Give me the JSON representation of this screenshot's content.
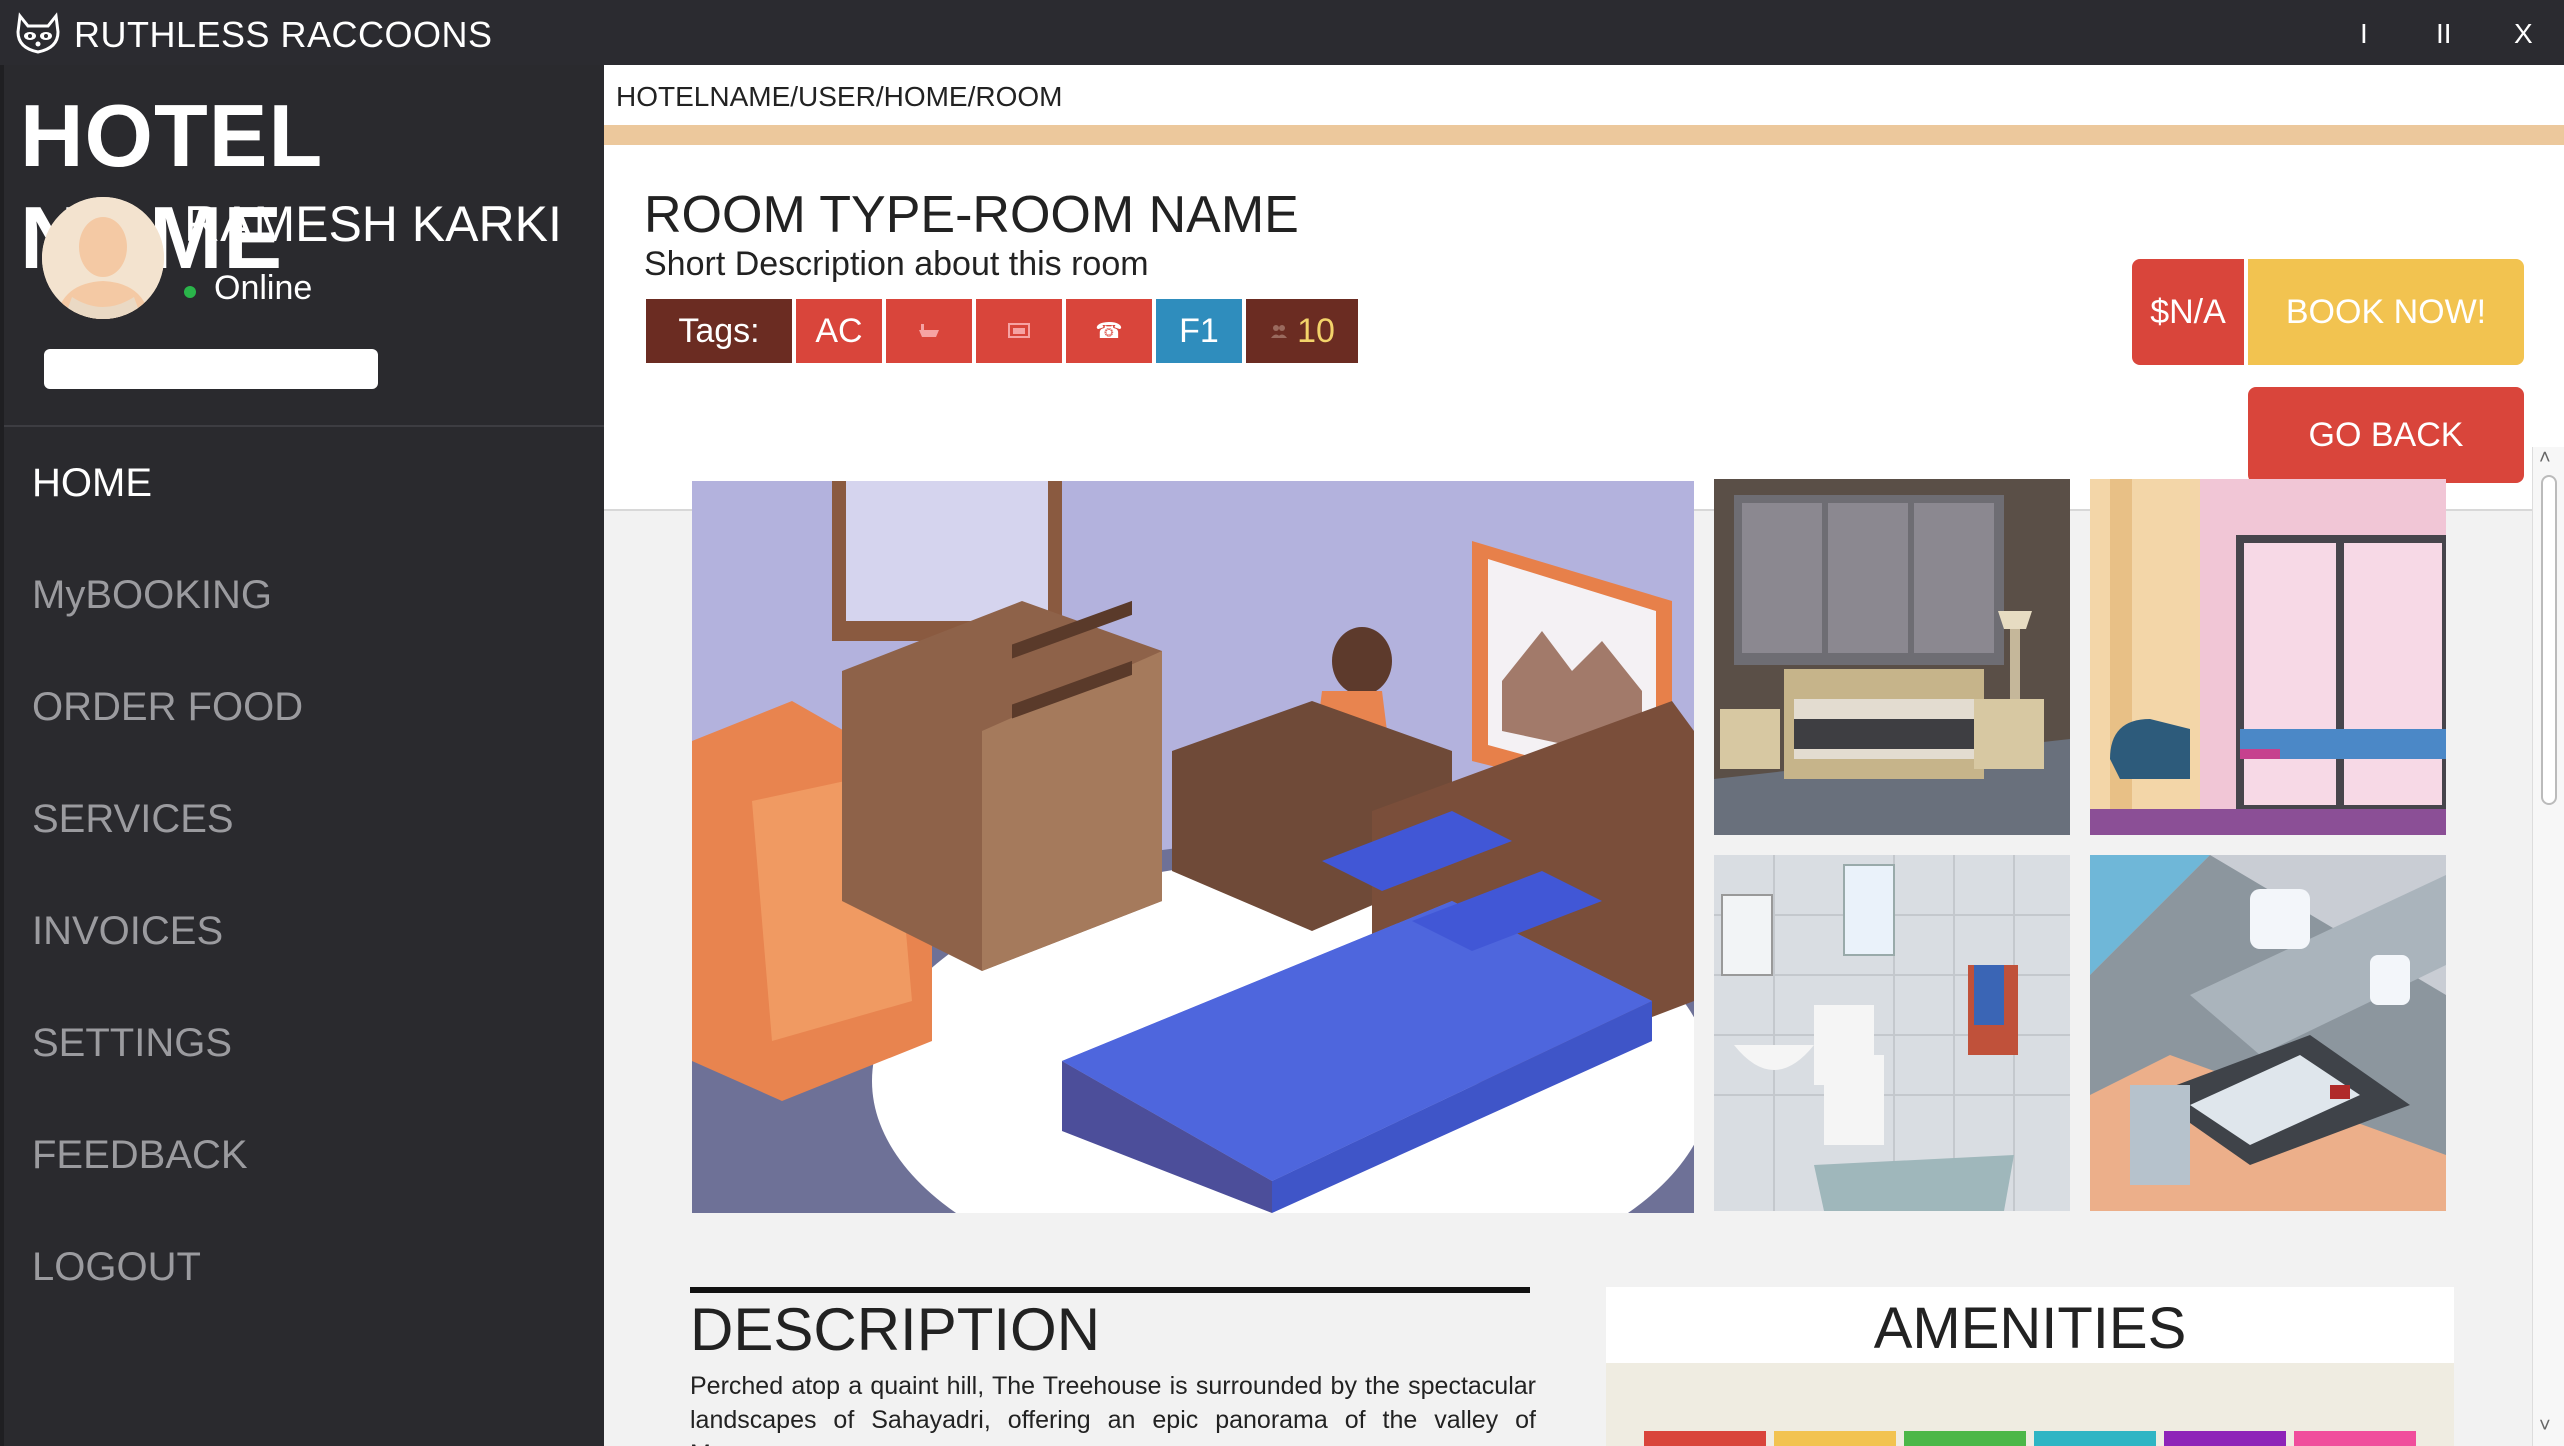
{
  "window": {
    "title": "RUTHLESS RACCOONS",
    "controls": {
      "minimize": "I",
      "maximize": "II",
      "close": "X"
    }
  },
  "sidebar": {
    "hotel_name": "HOTEL NAME",
    "user": {
      "name": "RAMESH KARKI",
      "status": "Online"
    },
    "nav": [
      {
        "label": "HOME",
        "active": true
      },
      {
        "label": "MyBOOKING"
      },
      {
        "label": "ORDER FOOD"
      },
      {
        "label": "SERVICES"
      },
      {
        "label": "INVOICES"
      },
      {
        "label": "SETTINGS"
      },
      {
        "label": "FEEDBACK"
      },
      {
        "label": "LOGOUT"
      }
    ]
  },
  "main": {
    "breadcrumb": "HOTELNAME/USER/HOME/ROOM",
    "room": {
      "title": "ROOM TYPE-ROOM NAME",
      "short_description": "Short Description about this room",
      "tags_label": "Tags:",
      "tags": {
        "ac": "AC",
        "bath_icon": "bathtub-icon",
        "tv_icon": "tv-icon",
        "phone_icon": "☎",
        "floor": "F1",
        "capacity_icon": "people-icon",
        "capacity": "10"
      }
    },
    "price": "$N/A",
    "book_label": "BOOK NOW!",
    "back_label": "GO BACK",
    "description": {
      "heading": "DESCRIPTION",
      "text": "Perched atop a quaint hill, The Treehouse is surrounded by the spectacular landscapes of  Sahayadri, offering an epic panorama of the valley of Marayoor."
    },
    "amenities": {
      "heading": "AMENITIES",
      "bar_colors": [
        "#d9453b",
        "#f2c350",
        "#4cb748",
        "#2fb5c4",
        "#8e24b8",
        "#f04e9c"
      ]
    }
  },
  "colors": {
    "accent_line": "#ecc89c",
    "danger": "#d9453b",
    "warning": "#f2c350",
    "tag_brown": "#6b2c22",
    "tag_blue": "#2f8dbd"
  }
}
